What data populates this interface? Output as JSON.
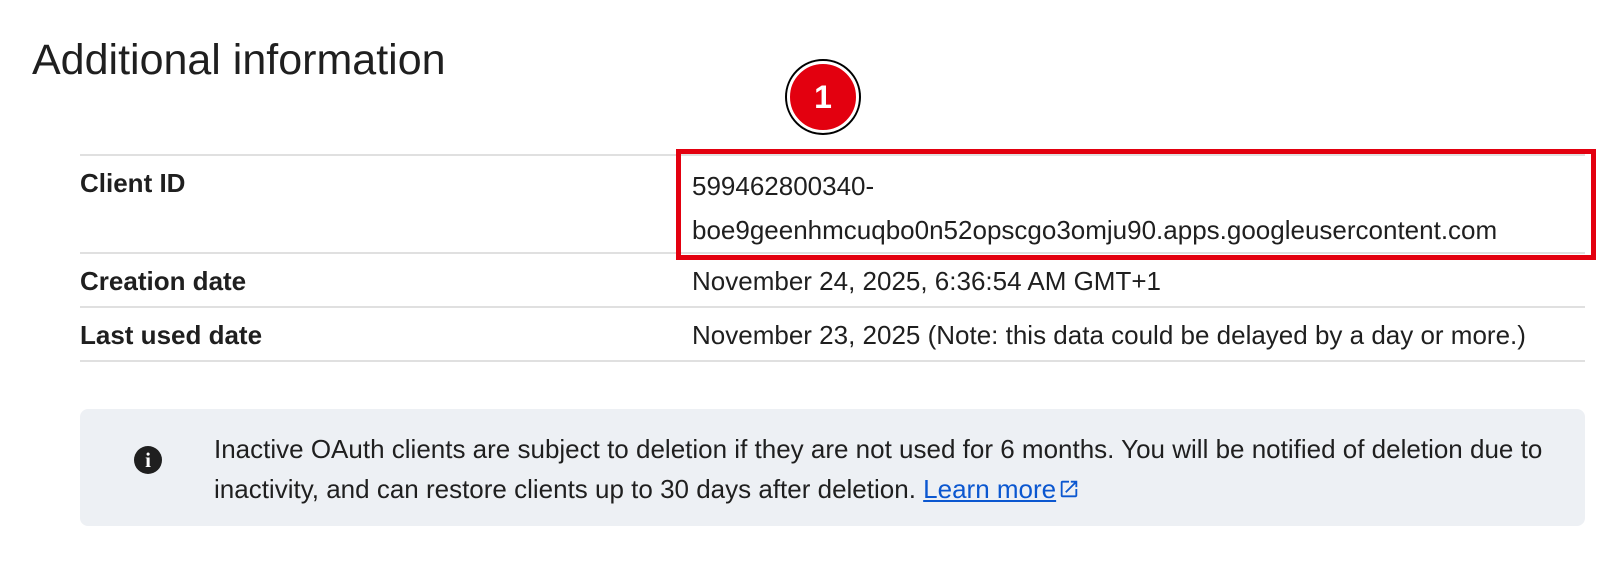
{
  "section": {
    "title": "Additional information"
  },
  "details": {
    "client_id": {
      "label": "Client ID",
      "value_line1": "599462800340-",
      "value_line2": "boe9geenhmcuqbo0n52opscgo3omju90.apps.googleusercontent.com"
    },
    "creation_date": {
      "label": "Creation date",
      "value": "November 24, 2025, 6:36:54 AM GMT+1"
    },
    "last_used_date": {
      "label": "Last used date",
      "value": "November 23, 2025 (Note: this data could be delayed by a day or more.)"
    }
  },
  "annotation": {
    "marker_number": "1",
    "color": "#e3000f"
  },
  "notice": {
    "icon": "info-icon",
    "text": "Inactive OAuth clients are subject to deletion if they are not used for 6 months. You will be notified of deletion due to inactivity, and can restore clients up to 30 days after deletion.",
    "link_label": "Learn more",
    "link_icon": "external-link-icon",
    "link_color": "#0b57d0"
  }
}
